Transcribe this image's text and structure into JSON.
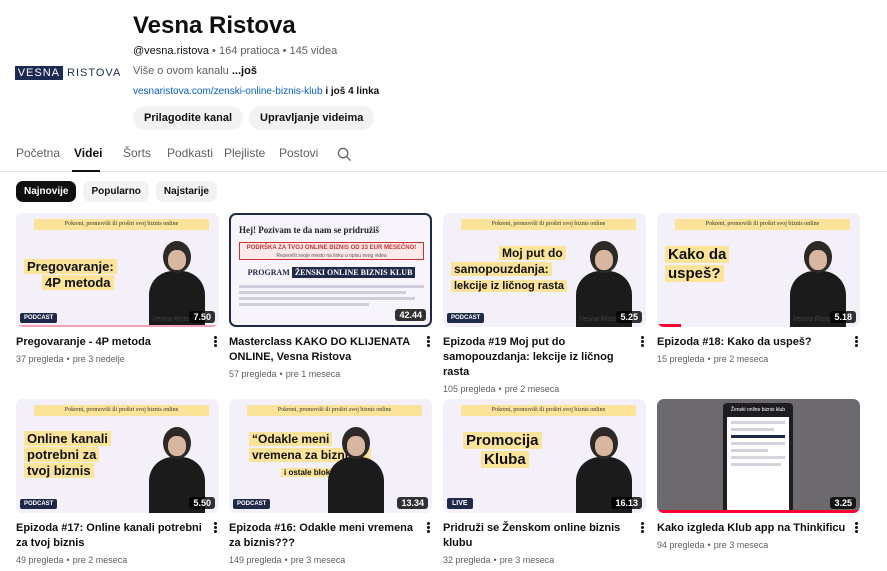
{
  "channel": {
    "name": "Vesna Ristova",
    "handle": "@vesna.ristova",
    "subscribers": "164 pratioca",
    "videos_count": "145 videa",
    "separator": "•",
    "about": "Više o ovom kanalu",
    "about_more": "...još",
    "link_url": "vesnaristova.com/zenski-online-biznis-klub",
    "link_extra": "i još 4 linka",
    "logo_part1": "VESNA",
    "logo_part2": "RISTOVA",
    "buttons": {
      "customize": "Prilagodite kanal",
      "manage": "Upravljanje videima"
    }
  },
  "tabs": [
    "Početna",
    "Videi",
    "Šorts",
    "Podkasti",
    "Plejliste",
    "Postovi"
  ],
  "active_tab": "Videi",
  "filters": [
    "Najnovije",
    "Popularno",
    "Najstarije"
  ],
  "active_filter": "Najnovije",
  "thumb_banner": "Pokreni, promoviši ili proširi svoj biznis online",
  "thumb_sign": "Vesna Ristova",
  "podcast_badge": "PODCAST",
  "live_badge": "LIVE",
  "promo_thumb": {
    "title": "Hej! Pozivam te da nam se pridružiš",
    "box_line1": "PODRŠKA ZA TVOJ ONLINE BIZNIS OD 33 EUR MESEČNO!",
    "box_line2": "Rezerviši svoje mesto na linku u opisu ovog videa",
    "program_prefix": "PROGRAM",
    "program_name": "ŽENSKI ONLINE BIZNIS KLUB"
  },
  "app_thumb": {
    "screen_title": "Ženski online biznis klub"
  },
  "videos": [
    {
      "title": "Pregovaranje - 4P metoda",
      "views": "37 pregleda",
      "age": "pre 3 nedelje",
      "duration": "7.50",
      "headline": [
        "Pregovaranje:",
        "4P metoda"
      ]
    },
    {
      "title": "Masterclass KAKO DO KLIJENATA ONLINE, Vesna Ristova",
      "views": "57 pregleda",
      "age": "pre 1 meseca",
      "duration": "42.44",
      "headline": []
    },
    {
      "title": "Epizoda #19 Moj put do samopouzdanja: lekcije iz ličnog rasta",
      "views": "105 pregleda",
      "age": "pre 2 meseca",
      "duration": "5.25",
      "headline": [
        "Moj put do",
        "samopouzdanja:",
        "lekcije iz ličnog rasta"
      ]
    },
    {
      "title": "Epizoda #18: Kako da uspeš?",
      "views": "15 pregleda",
      "age": "pre 2 meseca",
      "duration": "5.18",
      "headline": [
        "Kako da",
        "uspeš?"
      ]
    },
    {
      "title": "Epizoda #17: Online kanali potrebni za tvoj biznis",
      "views": "49 pregleda",
      "age": "pre 2 meseca",
      "duration": "5.50",
      "headline": [
        "Online kanali",
        "potrebni za",
        "tvoj biznis"
      ]
    },
    {
      "title": "Epizoda #16: Odakle meni vremena za biznis???",
      "views": "149 pregleda",
      "age": "pre 3 meseca",
      "duration": "13.34",
      "headline": [
        "“Odakle meni",
        "vremena za biznis?”",
        "i ostale blokade..."
      ]
    },
    {
      "title": "Pridruži se Ženskom online biznis klubu",
      "views": "32 pregleda",
      "age": "pre 3 meseca",
      "duration": "16.13",
      "headline": [
        "Promocija",
        "Kluba"
      ]
    },
    {
      "title": "Kako izgleda Klub app na Thinkificu",
      "views": "94 pregleda",
      "age": "pre 3 meseca",
      "duration": "3.25",
      "headline": []
    }
  ]
}
